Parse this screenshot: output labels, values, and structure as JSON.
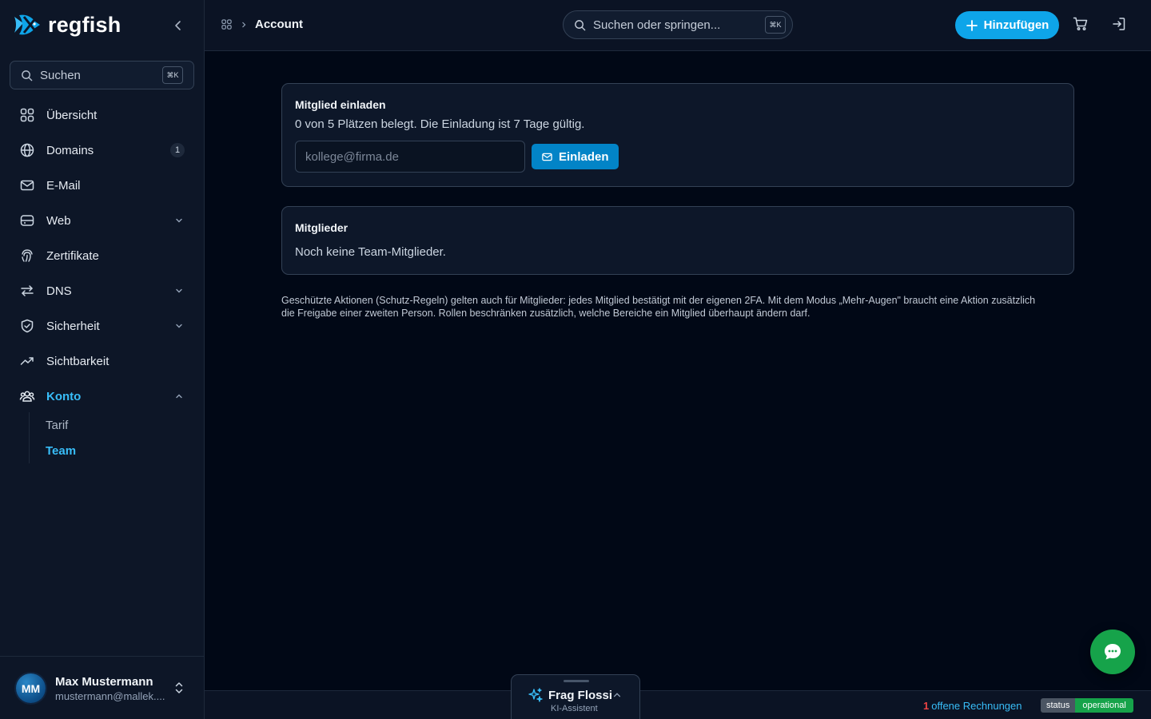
{
  "app": {
    "brand_name": "regfish",
    "colors": {
      "accent": "#0ea5e9",
      "active_nav": "#38bdf8",
      "success": "#16a34a",
      "danger": "#ef4444"
    }
  },
  "sidebar": {
    "search_label": "Suchen",
    "search_shortcut": "⌘K",
    "items": [
      {
        "label": "Übersicht",
        "icon": "grid-icon"
      },
      {
        "label": "Domains",
        "icon": "globe-icon",
        "badge": "1"
      },
      {
        "label": "E-Mail",
        "icon": "mail-icon"
      },
      {
        "label": "Web",
        "icon": "server-icon",
        "expandable": true
      },
      {
        "label": "Zertifikate",
        "icon": "fingerprint-icon"
      },
      {
        "label": "DNS",
        "icon": "arrows-icon",
        "expandable": true
      },
      {
        "label": "Sicherheit",
        "icon": "shield-icon",
        "expandable": true
      },
      {
        "label": "Sichtbarkeit",
        "icon": "trend-icon"
      },
      {
        "label": "Konto",
        "icon": "users-icon",
        "expandable": true,
        "expanded": true,
        "active": true
      }
    ],
    "subitems": [
      {
        "label": "Tarif",
        "active": false
      },
      {
        "label": "Team",
        "active": true
      }
    ],
    "user": {
      "initials": "MM",
      "name": "Max Mustermann",
      "email": "mustermann@mallek...."
    }
  },
  "topbar": {
    "breadcrumb_current": "Account",
    "search_placeholder": "Suchen oder springen...",
    "search_shortcut": "⌘K",
    "add_label": "Hinzufügen"
  },
  "main": {
    "invite": {
      "title": "Mitglied einladen",
      "subtitle": "0 von 5 Plätzen belegt. Die Einladung ist 7 Tage gültig.",
      "email_placeholder": "kollege@firma.de",
      "button_label": "Einladen"
    },
    "members": {
      "title": "Mitglieder",
      "empty_text": "Noch keine Team-Mitglieder."
    },
    "note_line1": "Geschützte Aktionen (Schutz-Regeln) gelten auch für Mitglieder: jedes Mitglied bestätigt mit der eigenen 2FA. Mit dem Modus „Mehr-Augen\" braucht eine Aktion zusätzlich",
    "note_line2": "die Freigabe einer zweiten Person. Rollen beschränken zusätzlich, welche Bereiche ein Mitglied überhaupt ändern darf."
  },
  "assistant": {
    "title": "Frag Flossi",
    "subtitle": "KI-Assistent"
  },
  "status_bar": {
    "invoice_count": "1",
    "invoice_label": "offene Rechnungen",
    "status_key": "status",
    "status_value": "operational"
  }
}
